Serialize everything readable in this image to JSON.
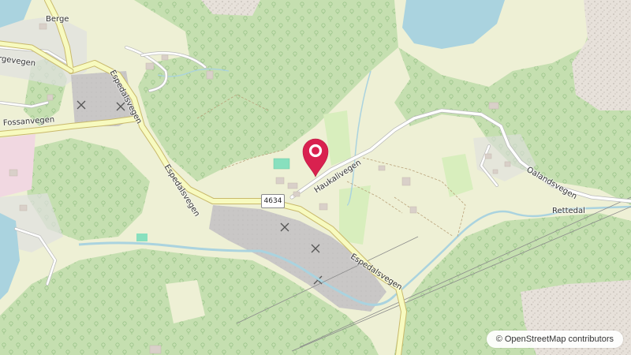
{
  "map": {
    "labels": {
      "berge": "Berge",
      "bergevegen": "rgevegen",
      "fossanvegen": "Fossanvegen",
      "espedalsvegen_west": "Espedalsvegen",
      "espedalsvegen_east": "Espedalsvegen",
      "haukalivegen": "Haukalivegen",
      "oalandsvegen": "Oalandsvegen",
      "rettedal": "Rettedal",
      "route_number": "4634"
    },
    "attribution": {
      "symbol": "©",
      "text": "OpenStreetMap contributors"
    },
    "marker": {
      "color": "#d9214f",
      "icon": "map-pin-icon"
    },
    "colors": {
      "forest": "#c5dfb0",
      "farmland": "#eef0d5",
      "water": "#aad3df",
      "quarry": "#c9c7c6",
      "rock": "#e7e1da",
      "road_major": "#f7fabf",
      "road_minor": "#ffffff"
    }
  }
}
